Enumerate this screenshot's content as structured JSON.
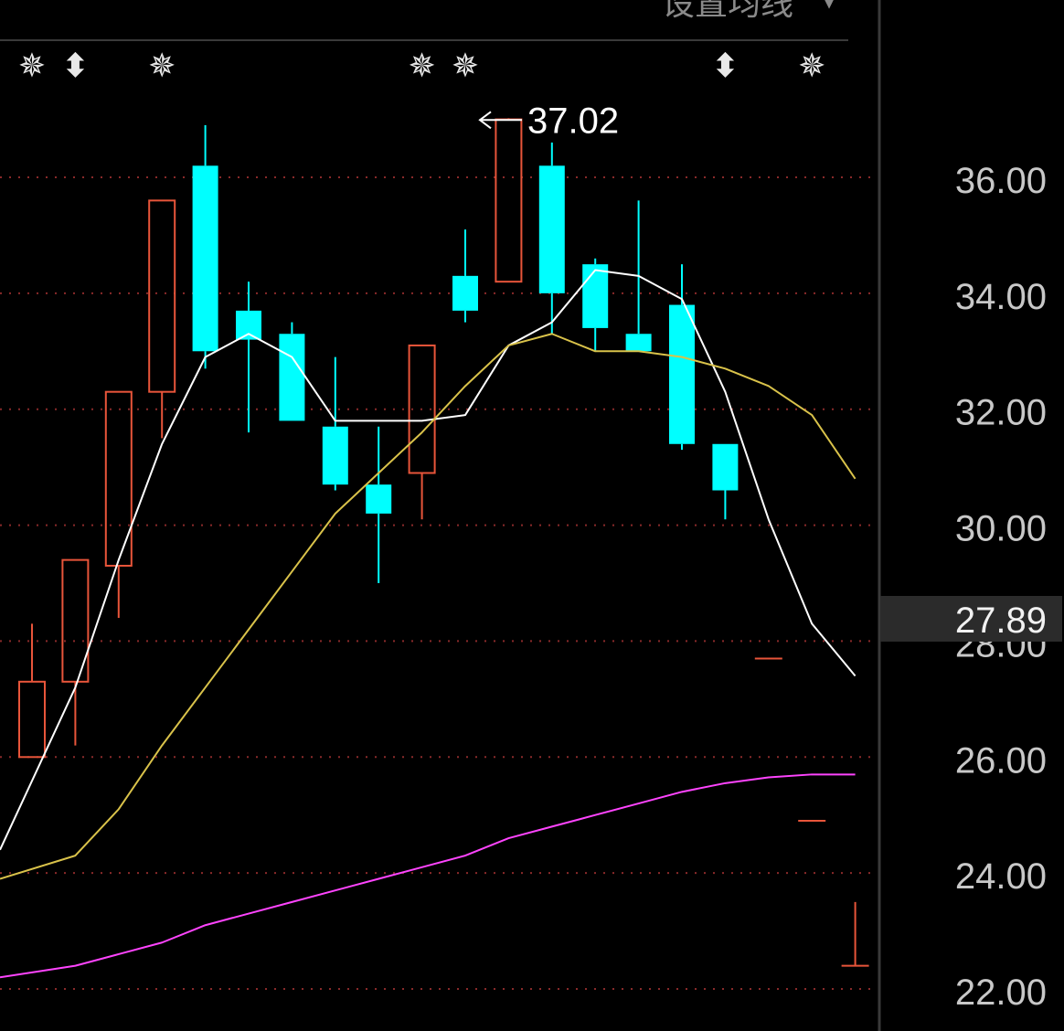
{
  "header": {
    "menu_label": "设置均线",
    "menu_arrow": "▾"
  },
  "current_price": {
    "label": "27.89",
    "value": 27.89
  },
  "high_annotation": {
    "label": "37.02",
    "value": 37.02,
    "candle_index": 10
  },
  "colors": {
    "up": "#e8553a",
    "down": "#00ffff",
    "ma_white": "#ffffff",
    "ma_yellow": "#d9c24a",
    "ma_magenta": "#ff44ff",
    "grid": "#8a2a2a",
    "background": "#000000"
  },
  "signals": [
    {
      "glyph": "✵",
      "candle_index": 0
    },
    {
      "glyph": "⬍",
      "candle_index": 1
    },
    {
      "glyph": "✵",
      "candle_index": 3
    },
    {
      "glyph": "✵",
      "candle_index": 9
    },
    {
      "glyph": "✵",
      "candle_index": 10
    },
    {
      "glyph": "⬍",
      "candle_index": 16
    },
    {
      "glyph": "✵",
      "candle_index": 18
    }
  ],
  "chart_data": {
    "type": "candlestick",
    "ylim": [
      21.5,
      38.9
    ],
    "y_ticks": [
      "36.00",
      "34.00",
      "32.00",
      "30.00",
      "28.00",
      "26.00",
      "24.00",
      "22.00"
    ],
    "y_tick_values": [
      36,
      34,
      32,
      30,
      28,
      26,
      24,
      22
    ],
    "grid": "dotted",
    "candles": [
      {
        "open": 26.0,
        "high": 28.3,
        "low": 26.2,
        "close": 27.3
      },
      {
        "open": 27.3,
        "high": 29.4,
        "low": 26.2,
        "close": 29.4
      },
      {
        "open": 29.3,
        "high": 32.3,
        "low": 28.4,
        "close": 32.3
      },
      {
        "open": 32.3,
        "high": 35.6,
        "low": 31.5,
        "close": 35.6
      },
      {
        "open": 36.2,
        "high": 36.9,
        "low": 32.7,
        "close": 33.0
      },
      {
        "open": 33.7,
        "high": 34.2,
        "low": 31.6,
        "close": 33.2
      },
      {
        "open": 33.3,
        "high": 33.5,
        "low": 31.8,
        "close": 31.8
      },
      {
        "open": 31.7,
        "high": 32.9,
        "low": 30.6,
        "close": 30.7
      },
      {
        "open": 30.7,
        "high": 31.7,
        "low": 29.0,
        "close": 30.2
      },
      {
        "open": 30.9,
        "high": 33.1,
        "low": 30.1,
        "close": 33.1
      },
      {
        "open": 34.3,
        "high": 35.1,
        "low": 33.5,
        "close": 33.7
      },
      {
        "open": 34.2,
        "high": 37.02,
        "low": 34.2,
        "close": 37.0
      },
      {
        "open": 36.2,
        "high": 36.6,
        "low": 33.3,
        "close": 34.0
      },
      {
        "open": 34.5,
        "high": 34.6,
        "low": 33.0,
        "close": 33.4
      },
      {
        "open": 33.3,
        "high": 35.6,
        "low": 33.0,
        "close": 33.0
      },
      {
        "open": 33.8,
        "high": 34.5,
        "low": 31.3,
        "close": 31.4
      },
      {
        "open": 31.4,
        "high": 31.4,
        "low": 30.1,
        "close": 30.6
      },
      {
        "open": 27.7,
        "high": 27.7,
        "low": 27.7,
        "close": 27.7
      },
      {
        "open": 24.9,
        "high": 24.9,
        "low": 24.9,
        "close": 24.9
      },
      {
        "open": 22.4,
        "high": 23.5,
        "low": 22.4,
        "close": 22.4
      }
    ],
    "series": [
      {
        "color": "#ffffff",
        "values": [
          24.4,
          27.2,
          29.4,
          31.4,
          32.9,
          33.3,
          32.9,
          31.8,
          31.8,
          31.8,
          31.9,
          33.1,
          33.5,
          34.4,
          34.3,
          33.9,
          32.3,
          30.1,
          28.3,
          27.4
        ]
      },
      {
        "color": "#d9c24a",
        "values": [
          23.9,
          24.3,
          25.1,
          26.2,
          27.2,
          28.2,
          29.2,
          30.2,
          30.9,
          31.6,
          32.4,
          33.1,
          33.3,
          33.0,
          33.0,
          32.9,
          32.7,
          32.4,
          31.9,
          30.8
        ]
      },
      {
        "color": "#ff44ff",
        "values": [
          22.2,
          22.4,
          22.6,
          22.8,
          23.1,
          23.3,
          23.5,
          23.7,
          23.9,
          24.1,
          24.3,
          24.6,
          24.8,
          25.0,
          25.2,
          25.4,
          25.55,
          25.65,
          25.7,
          25.7
        ]
      }
    ]
  }
}
